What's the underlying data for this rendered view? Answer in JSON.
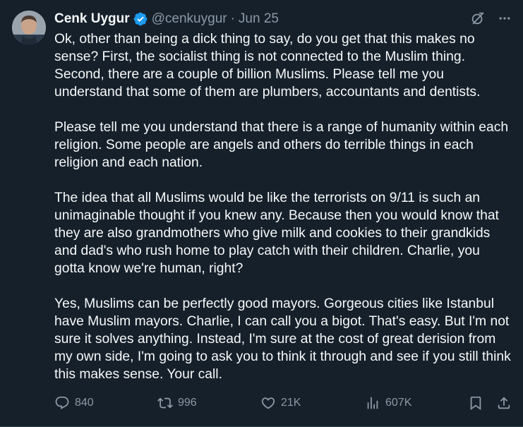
{
  "author": {
    "display_name": "Cenk Uygur",
    "handle": "@cenkuygur",
    "separator": "·",
    "date": "Jun 25",
    "verified": true
  },
  "colors": {
    "background": "#15202b",
    "text": "#f7f9f9",
    "muted": "#8b98a5",
    "verified_badge": "#1d9bf0"
  },
  "tweet": {
    "paragraphs": [
      "Ok, other than being a dick thing to say, do you get that this makes no sense? First, the socialist thing is not connected to the Muslim thing. Second, there are a couple of billion Muslims. Please tell me you understand that some of them are plumbers, accountants and dentists.",
      "Please tell me you understand that there is a range of humanity within each religion. Some people are angels and others do terrible things in each religion and each nation.",
      "The idea that all Muslims would be like the terrorists on 9/11 is such an unimaginable thought if you knew any. Because then you would know that they are also grandmothers who give milk and cookies to their grandkids and dad's who rush home to play catch with their children. Charlie, you gotta know we're human, right?",
      "Yes, Muslims can be perfectly good mayors. Gorgeous cities like Istanbul have Muslim mayors. Charlie, I can call you a bigot. That's easy. But I'm not sure it solves anything. Instead, I'm sure at the cost of great derision from my own side, I'm going to ask you to think it through and see if you still think this makes sense. Your call."
    ]
  },
  "header_icons": [
    "grok-icon",
    "more-icon"
  ],
  "actions": {
    "replies": "840",
    "retweets": "996",
    "likes": "21K",
    "views": "607K"
  }
}
